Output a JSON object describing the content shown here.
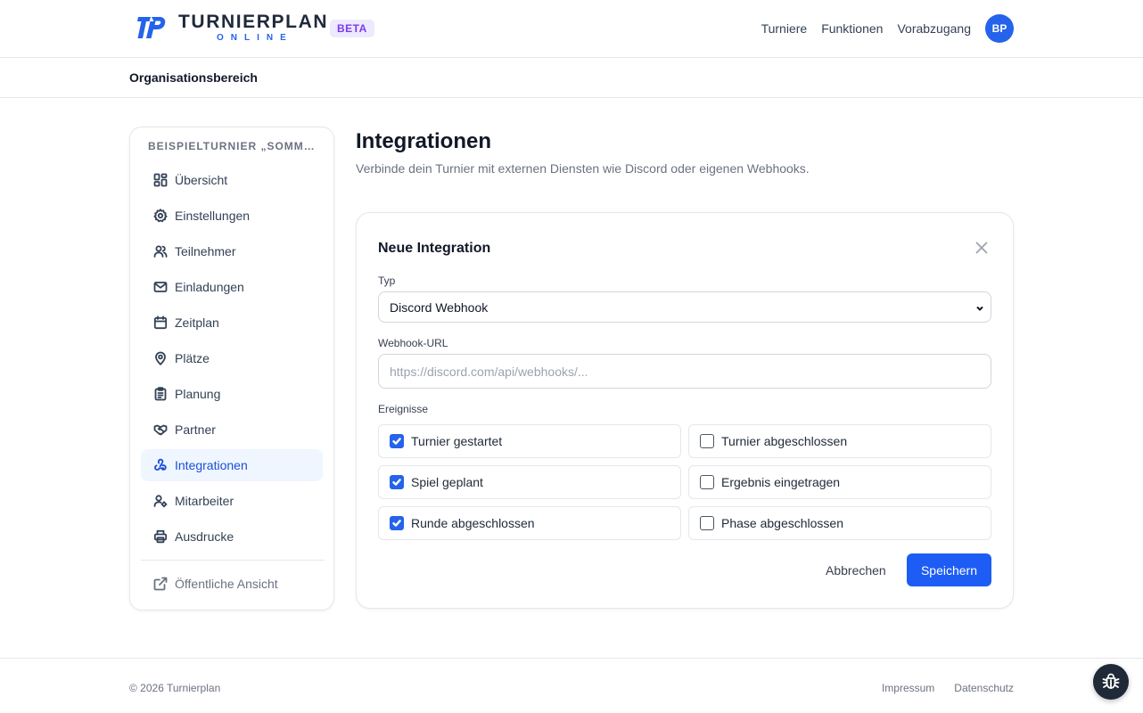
{
  "header": {
    "logo_title": "TURNIERPLAN",
    "logo_sub": "ONLINE",
    "badge": "BETA",
    "nav": [
      "Turniere",
      "Funktionen",
      "Vorabzugang"
    ],
    "avatar_initials": "BP"
  },
  "subheader": {
    "title": "Organisationsbereich"
  },
  "sidebar": {
    "tournament_name": "BEISPIELTURNIER „SOMMER...",
    "items": [
      {
        "label": "Übersicht",
        "icon": "dashboard-icon"
      },
      {
        "label": "Einstellungen",
        "icon": "gear-icon"
      },
      {
        "label": "Teilnehmer",
        "icon": "users-icon"
      },
      {
        "label": "Einladungen",
        "icon": "mail-icon"
      },
      {
        "label": "Zeitplan",
        "icon": "calendar-icon"
      },
      {
        "label": "Plätze",
        "icon": "map-pin-icon"
      },
      {
        "label": "Planung",
        "icon": "clipboard-icon"
      },
      {
        "label": "Partner",
        "icon": "handshake-icon"
      },
      {
        "label": "Integrationen",
        "icon": "webhook-icon",
        "active": true
      },
      {
        "label": "Mitarbeiter",
        "icon": "user-gear-icon"
      },
      {
        "label": "Ausdrucke",
        "icon": "printer-icon"
      }
    ],
    "public_view": "Öffentliche Ansicht"
  },
  "main": {
    "title": "Integrationen",
    "description": "Verbinde dein Turnier mit externen Diensten wie Discord oder eigenen Webhooks."
  },
  "form": {
    "title": "Neue Integration",
    "type_label": "Typ",
    "type_value": "Discord Webhook",
    "url_label": "Webhook-URL",
    "url_placeholder": "https://discord.com/api/webhooks/...",
    "events_label": "Ereignisse",
    "events": [
      {
        "label": "Turnier gestartet",
        "checked": true
      },
      {
        "label": "Turnier abgeschlossen",
        "checked": false
      },
      {
        "label": "Spiel geplant",
        "checked": true
      },
      {
        "label": "Ergebnis eingetragen",
        "checked": false
      },
      {
        "label": "Runde abgeschlossen",
        "checked": true
      },
      {
        "label": "Phase abgeschlossen",
        "checked": false
      }
    ],
    "cancel": "Abbrechen",
    "save": "Speichern"
  },
  "footer": {
    "copyright": "© 2026 Turnierplan",
    "links": [
      "Impressum",
      "Datenschutz"
    ]
  },
  "colors": {
    "accent": "#2563eb",
    "save_button": "#1d5cf5",
    "active_bg": "#eff6ff",
    "beta_bg": "#ede9fe",
    "beta_text": "#7c3aed"
  }
}
